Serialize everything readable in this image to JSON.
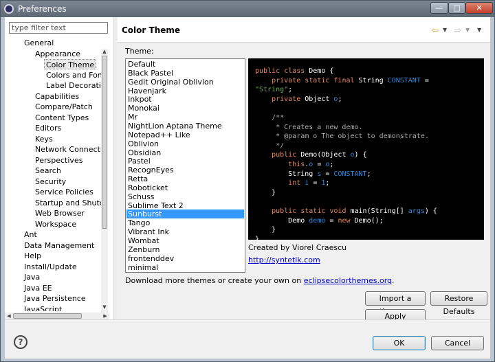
{
  "window": {
    "title": "Preferences",
    "minimize_glyph": "—",
    "maximize_glyph": "□",
    "close_glyph": "✕"
  },
  "filter": {
    "placeholder": "type filter text",
    "value": ""
  },
  "tree": {
    "items": [
      {
        "label": "General",
        "level": 1
      },
      {
        "label": "Appearance",
        "level": 2
      },
      {
        "label": "Color Theme",
        "level": 3,
        "selected": true
      },
      {
        "label": "Colors and Fonts",
        "level": 3
      },
      {
        "label": "Label Decorations",
        "level": 3
      },
      {
        "label": "Capabilities",
        "level": 2
      },
      {
        "label": "Compare/Patch",
        "level": 2
      },
      {
        "label": "Content Types",
        "level": 2
      },
      {
        "label": "Editors",
        "level": 2
      },
      {
        "label": "Keys",
        "level": 2
      },
      {
        "label": "Network Connections",
        "level": 2
      },
      {
        "label": "Perspectives",
        "level": 2
      },
      {
        "label": "Search",
        "level": 2
      },
      {
        "label": "Security",
        "level": 2
      },
      {
        "label": "Service Policies",
        "level": 2
      },
      {
        "label": "Startup and Shutdown",
        "level": 2
      },
      {
        "label": "Web Browser",
        "level": 2
      },
      {
        "label": "Workspace",
        "level": 2
      },
      {
        "label": "Ant",
        "level": 1
      },
      {
        "label": "Data Management",
        "level": 1
      },
      {
        "label": "Help",
        "level": 1
      },
      {
        "label": "Install/Update",
        "level": 1
      },
      {
        "label": "Java",
        "level": 1
      },
      {
        "label": "Java EE",
        "level": 1
      },
      {
        "label": "Java Persistence",
        "level": 1
      },
      {
        "label": "JavaScript",
        "level": 1
      }
    ]
  },
  "page": {
    "title": "Color Theme",
    "nav_back_icon": "arrow-left-icon",
    "nav_forward_icon": "arrow-right-icon",
    "theme_label": "Theme:",
    "themes": [
      "Default",
      "Black Pastel",
      "Gedit Original Oblivion",
      "Havenjark",
      "Inkpot",
      "Monokai",
      "Mr",
      "NightLion Aptana Theme",
      "Notepad++ Like",
      "Oblivion",
      "Obsidian",
      "Pastel",
      "RecognEyes",
      "Retta",
      "Roboticket",
      "Schuss",
      "Sublime Text 2",
      "Sunburst",
      "Tango",
      "Vibrant Ink",
      "Wombat",
      "Zenburn",
      "frontenddev",
      "minimal"
    ],
    "selected_theme": "Sunburst",
    "author": "Created by Viorel Craescu",
    "author_url": "http://syntetik.com",
    "download_text": "Download more themes or create your own on ",
    "download_link": "eclipsecolorthemes.org",
    "download_suffix": "."
  },
  "buttons": {
    "import": "Import a theme...",
    "restore": "Restore Defaults",
    "apply": "Apply",
    "ok": "OK",
    "cancel": "Cancel"
  },
  "colors": {
    "keyword": "#e28964",
    "constant": "#3387cc",
    "string": "#65b042",
    "comment": "#aeaeae",
    "selection": "#3399ff",
    "preview_bg": "#000000"
  }
}
